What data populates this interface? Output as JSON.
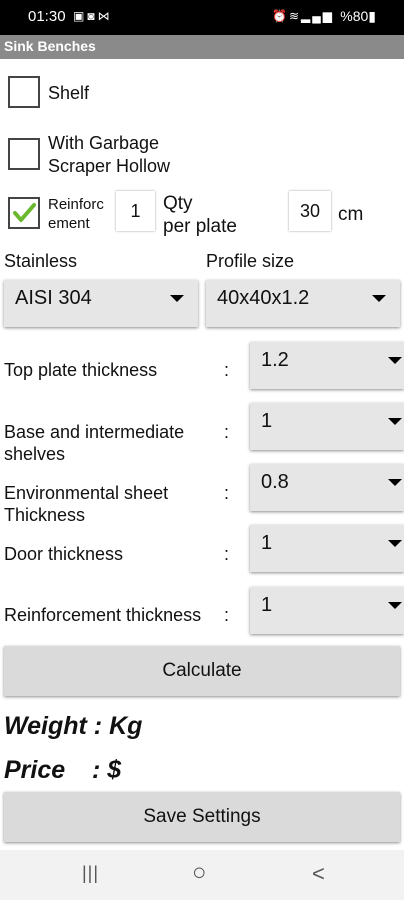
{
  "status_bar": {
    "time": "01:30",
    "battery": "%80",
    "left_icons": [
      "image-icon",
      "instagram-icon",
      "media-icon"
    ],
    "right_icons": [
      "alarm-icon",
      "wifi-icon",
      "signal-icon"
    ]
  },
  "app": {
    "title": "Sink Benches"
  },
  "options": {
    "shelf": {
      "label": "Shelf",
      "checked": false
    },
    "garbage": {
      "label_line1": "With Garbage",
      "label_line2": "Scraper Hollow",
      "checked": false
    },
    "reinforcement": {
      "label_line1": "Reinforc",
      "label_line2": "ement",
      "checked": true,
      "qty_value": "1",
      "qty_label_line1": "Qty",
      "qty_label_line2": "per plate",
      "cm_value": "30",
      "cm_unit": "cm"
    }
  },
  "selectors": {
    "stainless": {
      "label": "Stainless",
      "value": "AISI 304"
    },
    "profile": {
      "label": "Profile size",
      "value": "40x40x1.2"
    }
  },
  "thickness_rows": [
    {
      "label_line1": "Top plate thickness",
      "label_line2": "",
      "value": "1.2"
    },
    {
      "label_line1": "Base and intermediate",
      "label_line2": "shelves",
      "value": "1"
    },
    {
      "label_line1": "Environmental sheet",
      "label_line2": "Thickness",
      "value": "0.8"
    },
    {
      "label_line1": "Door thickness",
      "label_line2": "",
      "value": "1"
    },
    {
      "label_line1": "Reinforcement thickness",
      "label_line2": "",
      "value": "1"
    }
  ],
  "colon": ":",
  "buttons": {
    "calculate": "Calculate",
    "save": "Save Settings"
  },
  "results": {
    "weight_label": "Weight :",
    "weight_unit": "Kg",
    "price_label": "Price",
    "price_colon": ":",
    "price_unit": "$"
  },
  "nav": {
    "recents": "|||",
    "home": "○",
    "back": "<"
  },
  "colors": {
    "checkmark": "#6ab82e",
    "title_bar": "#8a8a8a",
    "spinner": "#e6e6e6"
  }
}
